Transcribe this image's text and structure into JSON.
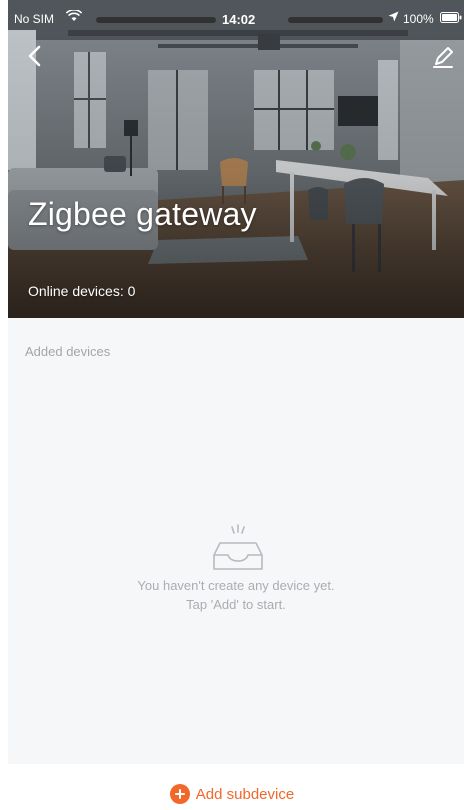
{
  "status_bar": {
    "carrier": "No SIM",
    "time": "14:02",
    "battery": "100%"
  },
  "header": {
    "back_icon": "chevron-left-icon",
    "edit_icon": "pencil-icon",
    "title": "Zigbee gateway",
    "online_devices": "Online devices: 0"
  },
  "section": {
    "label": "Added devices"
  },
  "empty_state": {
    "icon": "empty-inbox-icon",
    "line1": "You haven't create any device yet.",
    "line2": "Tap 'Add' to start."
  },
  "action": {
    "icon": "plus-circle-icon",
    "label": "Add subdevice"
  },
  "colors": {
    "accent": "#f2672a",
    "body_background": "#f6f7f9",
    "muted_text": "#a9adb2"
  }
}
